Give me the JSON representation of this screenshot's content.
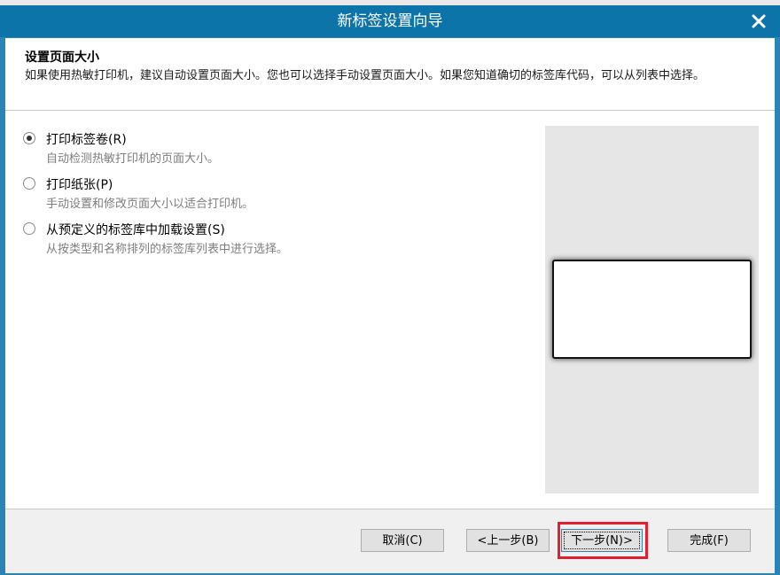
{
  "dialog": {
    "title": "新标签设置向导",
    "close_icon": "close-icon"
  },
  "header": {
    "title": "设置页面大小",
    "description": "如果使用热敏打印机，建议自动设置页面大小。您也可以选择手动设置页面大小。如果您知道确切的标签库代码，可以从列表中选择。"
  },
  "options": [
    {
      "label": "打印标签卷(R)",
      "description": "自动检测热敏打印机的页面大小。",
      "selected": true
    },
    {
      "label": "打印纸张(P)",
      "description": "手动设置和修改页面大小以适合打印机。",
      "selected": false
    },
    {
      "label": "从预定义的标签库中加载设置(S)",
      "description": "从按类型和名称排列的标签库列表中进行选择。",
      "selected": false
    }
  ],
  "buttons": {
    "cancel": "取消(C)",
    "back": "<上一步(B)",
    "next": "下一步(N)>",
    "finish": "完成(F)"
  },
  "colors": {
    "titlebar": "#0d74aa",
    "highlight": "#e0202f"
  }
}
